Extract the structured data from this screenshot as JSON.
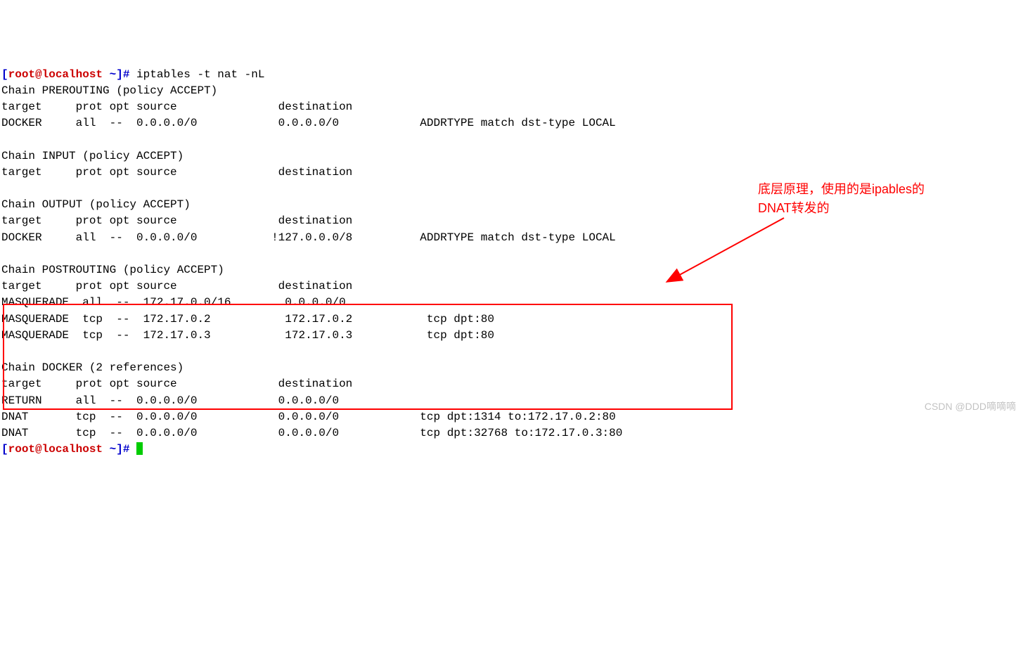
{
  "prompt": {
    "open": "[",
    "user_host": "root@localhost",
    "path": " ~",
    "close": "]# "
  },
  "command": "iptables -t nat -nL",
  "chains": {
    "prerouting": {
      "header": "Chain PREROUTING (policy ACCEPT)",
      "columns": "target     prot opt source               destination",
      "rows": [
        "DOCKER     all  --  0.0.0.0/0            0.0.0.0/0            ADDRTYPE match dst-type LOCAL"
      ]
    },
    "input": {
      "header": "Chain INPUT (policy ACCEPT)",
      "columns": "target     prot opt source               destination"
    },
    "output": {
      "header": "Chain OUTPUT (policy ACCEPT)",
      "columns": "target     prot opt source               destination",
      "rows": [
        "DOCKER     all  --  0.0.0.0/0           !127.0.0.0/8          ADDRTYPE match dst-type LOCAL"
      ]
    },
    "postrouting": {
      "header": "Chain POSTROUTING (policy ACCEPT)",
      "columns": "target     prot opt source               destination",
      "rows": [
        "MASQUERADE  all  --  172.17.0.0/16        0.0.0.0/0",
        "MASQUERADE  tcp  --  172.17.0.2           172.17.0.2           tcp dpt:80",
        "MASQUERADE  tcp  --  172.17.0.3           172.17.0.3           tcp dpt:80"
      ]
    },
    "docker": {
      "header": "Chain DOCKER (2 references)",
      "columns": "target     prot opt source               destination",
      "rows": [
        "RETURN     all  --  0.0.0.0/0            0.0.0.0/0",
        "DNAT       tcp  --  0.0.0.0/0            0.0.0.0/0            tcp dpt:1314 to:172.17.0.2:80",
        "DNAT       tcp  --  0.0.0.0/0            0.0.0.0/0            tcp dpt:32768 to:172.17.0.3:80"
      ]
    }
  },
  "annotation": {
    "line1": "底层原理，使用的是ipables的",
    "line2": "DNAT转发的"
  },
  "watermark": "CSDN @DDD嘀嘀嘀"
}
